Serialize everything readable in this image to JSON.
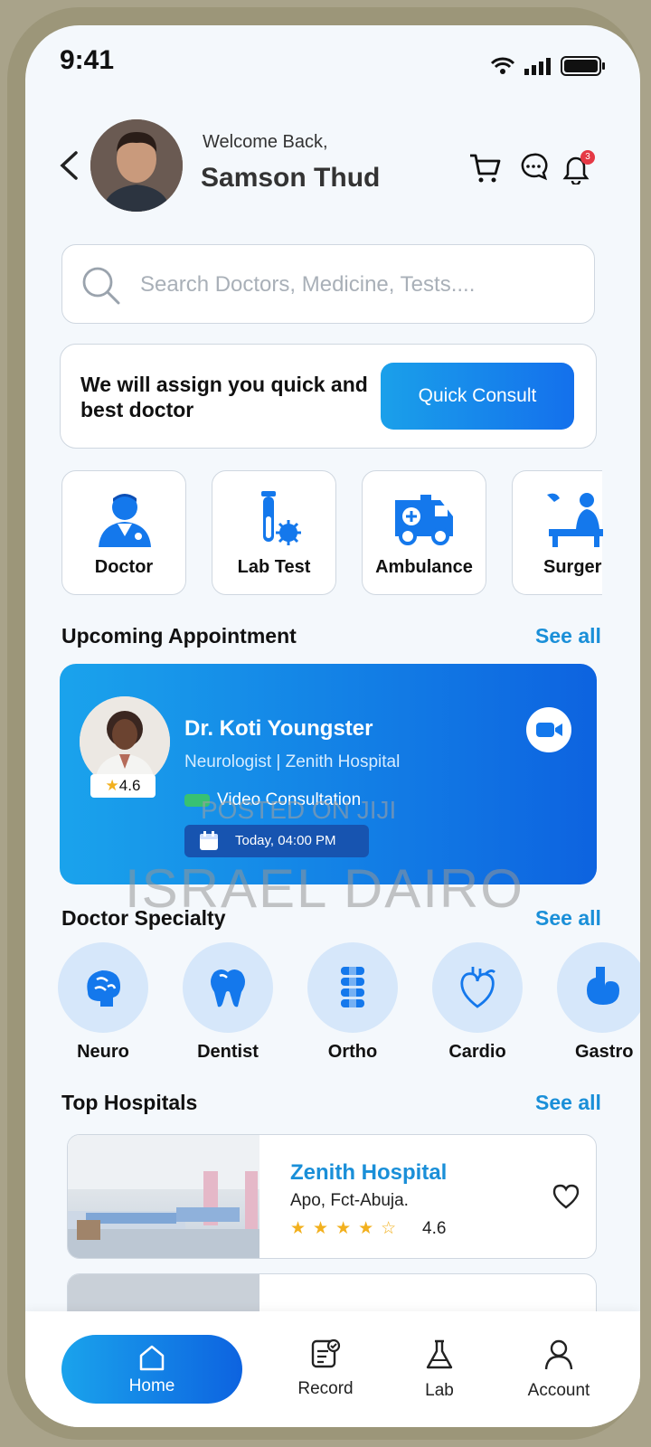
{
  "status": {
    "time": "9:41"
  },
  "header": {
    "welcome": "Welcome Back,",
    "user_name": "Samson Thud",
    "notification_count": "3"
  },
  "search": {
    "placeholder": "Search Doctors, Medicine, Tests...."
  },
  "quick_consult": {
    "text": "We will assign you quick and best doctor",
    "button": "Quick Consult"
  },
  "services": [
    {
      "label": "Doctor",
      "icon": "doctor-icon"
    },
    {
      "label": "Lab Test",
      "icon": "test-tube-icon"
    },
    {
      "label": "Ambulance",
      "icon": "ambulance-icon"
    },
    {
      "label": "Surger",
      "icon": "surgery-icon"
    }
  ],
  "appointment": {
    "section_title": "Upcoming Appointment",
    "see_all": "See all",
    "doctor": "Dr. Koti Youngster",
    "specialty": "Neurologist | Zenith Hospital",
    "rating": "4.6",
    "type": "Video Consultation",
    "time": "Today, 04:00 PM"
  },
  "specialty": {
    "section_title": "Doctor Specialty",
    "see_all": "See all",
    "items": [
      {
        "label": "Neuro",
        "icon": "brain-icon"
      },
      {
        "label": "Dentist",
        "icon": "tooth-icon"
      },
      {
        "label": "Ortho",
        "icon": "spine-icon"
      },
      {
        "label": "Cardio",
        "icon": "heart-organ-icon"
      },
      {
        "label": "Gastro",
        "icon": "stomach-icon"
      }
    ]
  },
  "hospitals": {
    "section_title": "Top Hospitals",
    "see_all": "See all",
    "items": [
      {
        "name": "Zenith Hospital",
        "location": "Apo, Fct-Abuja.",
        "stars": "★★★★☆",
        "rating": "4.6"
      }
    ]
  },
  "nav": {
    "home": "Home",
    "record": "Record",
    "lab": "Lab",
    "account": "Account"
  },
  "watermark": {
    "line1": "POSTED ON JIJI",
    "line2": "ISRAEL DAIRO"
  },
  "colors": {
    "accent": "#1478ec",
    "link": "#1a8fd8",
    "icon_bg": "#d6e7fa"
  }
}
